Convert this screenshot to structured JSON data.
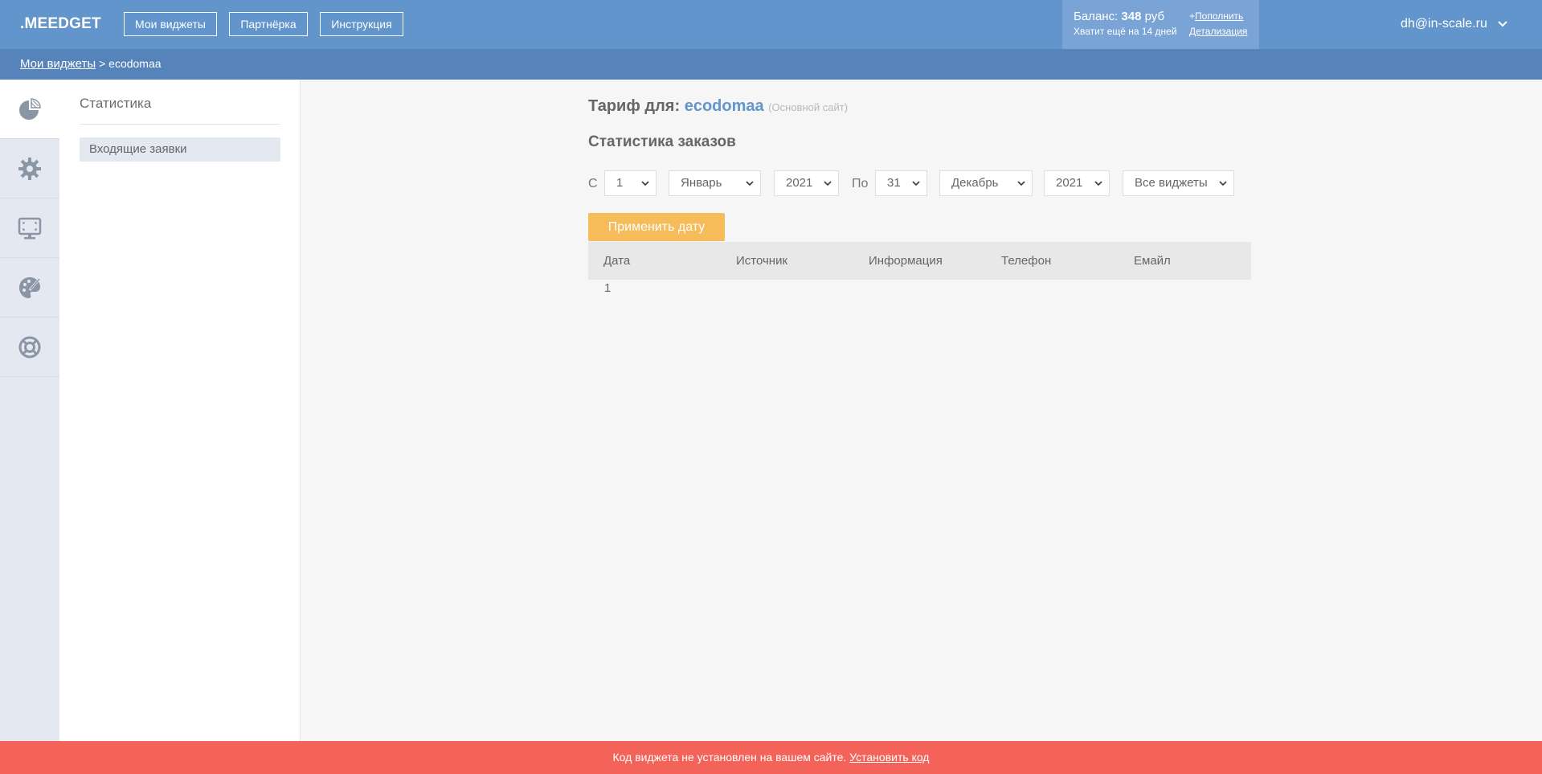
{
  "header": {
    "logo": ".MEEDGET",
    "nav": [
      "Мои виджеты",
      "Партнёрка",
      "Инструкция"
    ],
    "balance_label": "Баланс:",
    "balance_amount": "348",
    "balance_currency": "руб",
    "balance_remaining": "Хватит ещё на 14 дней",
    "topup_plus": "+",
    "topup_link": "Пополнить",
    "details_link": "Детализация",
    "user_email": "dh@in-scale.ru"
  },
  "breadcrumb": {
    "root": "Мои виджеты",
    "separator": ">",
    "current": "ecodomaa"
  },
  "sidebar_icons": [
    "pie-chart-icon",
    "gear-icon",
    "monitor-icon",
    "palette-icon",
    "lifebuoy-icon"
  ],
  "subpanel": {
    "title": "Статистика",
    "items": [
      "Входящие заявки"
    ]
  },
  "main": {
    "tariff_label": "Тариф для:",
    "tariff_site": "ecodomaa",
    "tariff_note": "(Основной сайт)",
    "stats_title": "Статистика заказов",
    "from_label": "С",
    "to_label": "По",
    "from_day": "1",
    "from_month": "Январь",
    "from_year": "2021",
    "to_day": "31",
    "to_month": "Декабрь",
    "to_year": "2021",
    "widget_filter": "Все виджеты",
    "apply_button": "Применить дату",
    "table": {
      "columns": [
        "Дата",
        "Источник",
        "Информация",
        "Телефон",
        "Емайл"
      ],
      "rows": [
        "1"
      ]
    }
  },
  "footer": {
    "message": "Код виджета не установлен на вашем сайте.",
    "link": "Установить код"
  },
  "colors": {
    "header": "#6395cd",
    "breadcrumb_bar": "#5583ba",
    "balance_box": "#7aa4d5",
    "accent_button": "#f6bc5a",
    "alert_bar": "#f4635a",
    "icon_gray": "#8a95a5"
  }
}
